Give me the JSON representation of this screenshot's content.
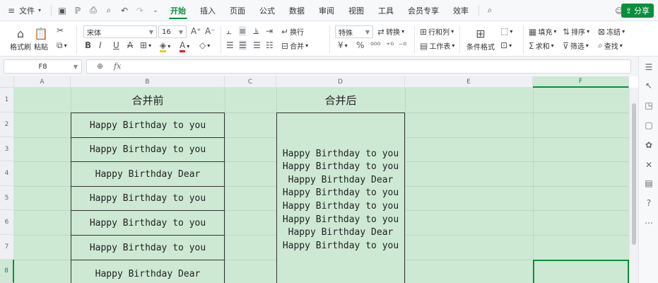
{
  "menubar": {
    "file": "文件",
    "tabs": [
      "开始",
      "插入",
      "页面",
      "公式",
      "数据",
      "审阅",
      "视图",
      "工具",
      "会员专享",
      "效率"
    ],
    "active_tab": "开始",
    "share": "分享"
  },
  "ribbon": {
    "format_painter": "格式刷",
    "paste": "粘贴",
    "font_name": "宋体",
    "font_size": "16",
    "wrap": "换行",
    "merge": "合并",
    "number_format": "特殊",
    "convert": "转换",
    "row_col": "行和列",
    "worksheet": "工作表",
    "cond_format": "条件格式",
    "fill": "填充",
    "sort": "排序",
    "freeze": "冻结",
    "sum": "求和",
    "filter": "筛选",
    "find": "查找"
  },
  "formula_bar": {
    "name_box": "F8",
    "fx": "fx",
    "value": ""
  },
  "columns": [
    "A",
    "B",
    "C",
    "D",
    "E",
    "F"
  ],
  "selected_column": "F",
  "rows": [
    "1",
    "2",
    "3",
    "4",
    "5",
    "6",
    "7",
    "8"
  ],
  "selected_row": "8",
  "cells": {
    "b1": "合并前",
    "d1": "合并后",
    "b_list": [
      "Happy Birthday to you",
      "Happy Birthday to you",
      "Happy Birthday Dear",
      "Happy Birthday to you",
      "Happy Birthday to you",
      "Happy Birthday to you",
      "Happy Birthday Dear"
    ],
    "d_merged": [
      "Happy Birthday to you",
      "Happy Birthday to you",
      "Happy Birthday Dear",
      "Happy Birthday to you",
      "Happy Birthday to you",
      "Happy Birthday to you",
      "Happy Birthday Dear",
      "Happy Birthday to you"
    ]
  },
  "colors": {
    "accent": "#0a8f3c",
    "sheet_bg": "#cde9d3"
  }
}
